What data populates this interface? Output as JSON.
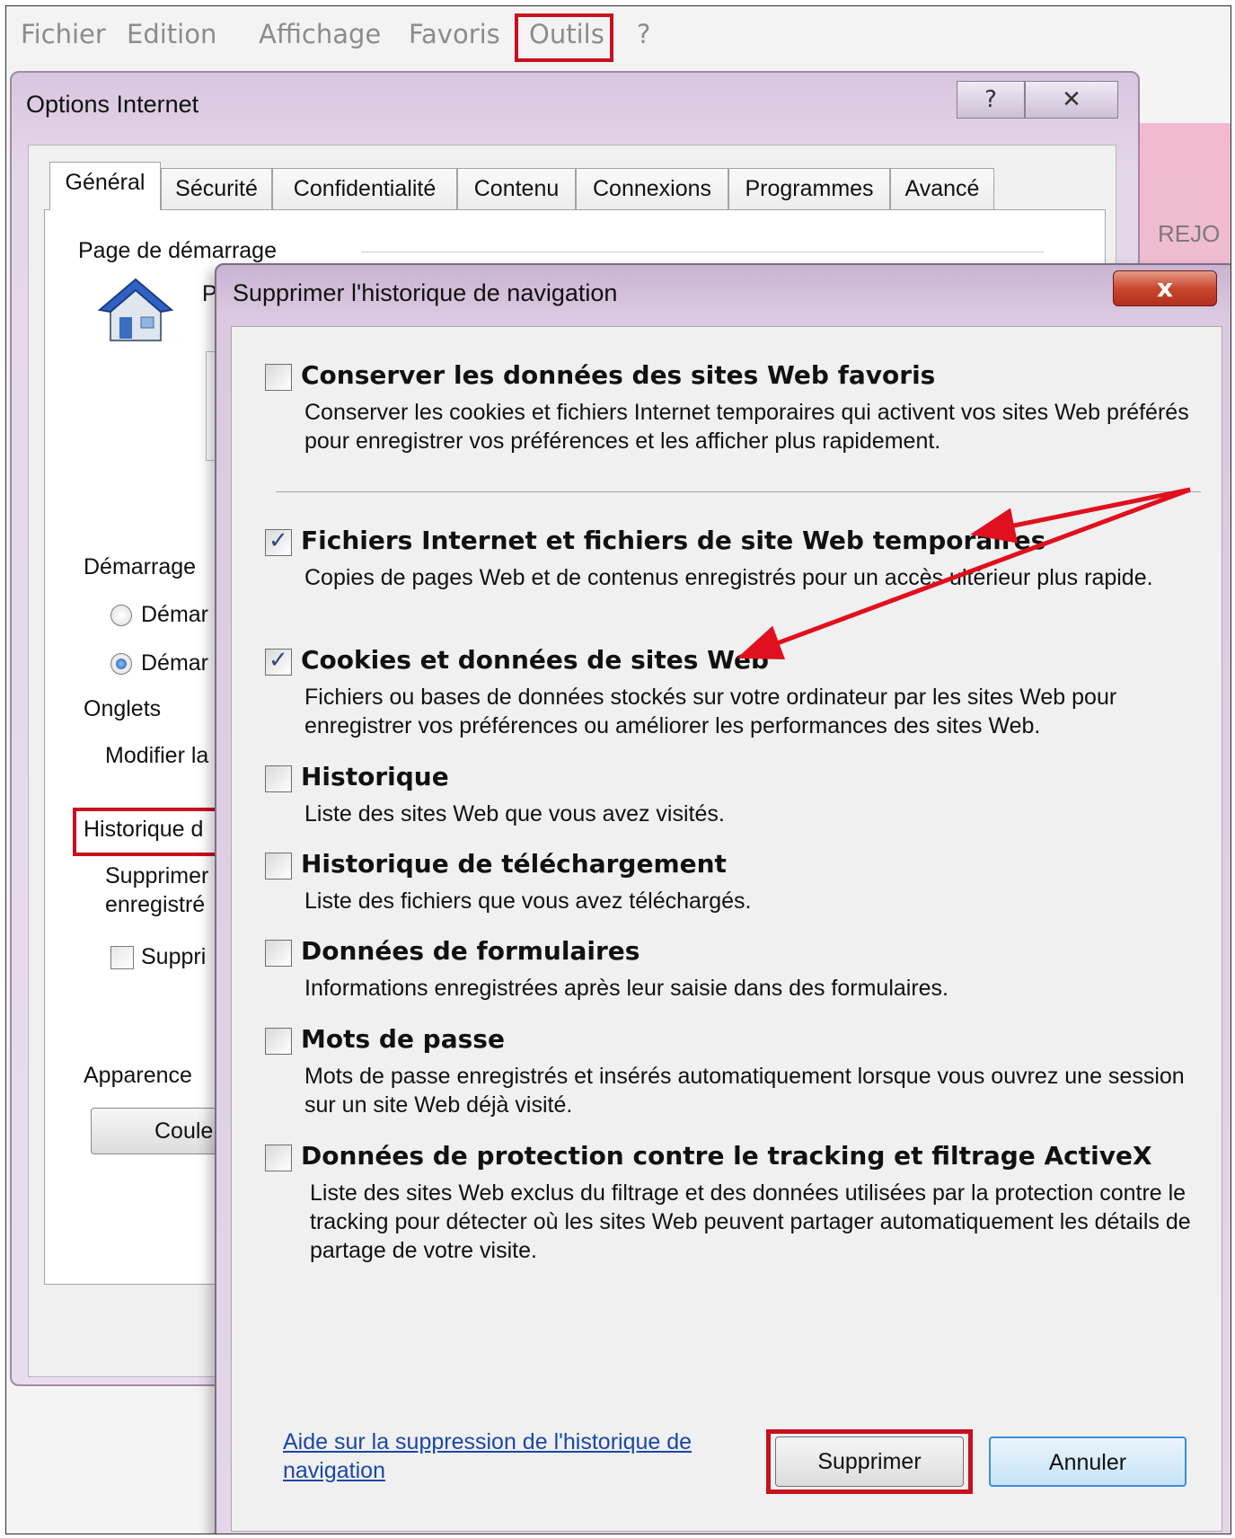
{
  "menubar": {
    "items": [
      "Fichier",
      "Edition",
      "Affichage",
      "Favoris",
      "Outils",
      "?"
    ]
  },
  "background_app": {
    "text": "REJO"
  },
  "options_window": {
    "title": "Options Internet",
    "help_button": "?",
    "close_button": "✕",
    "tabs": [
      "Général",
      "Sécurité",
      "Confidentialité",
      "Contenu",
      "Connexions",
      "Programmes",
      "Avancé"
    ],
    "page_demarrage": "Page de démarrage",
    "p_label": "P",
    "demarrage": "Démarrage",
    "radio1": "Démar",
    "radio2": "Démar",
    "onglets": "Onglets",
    "modifier": "Modifier la",
    "historique": "Historique d",
    "supprimer_text_1": "Supprimer",
    "supprimer_text_2": "enregistré",
    "suppr_checkbox": "Suppri",
    "apparence": "Apparence",
    "couleurs": "Coule"
  },
  "dialog": {
    "title": "Supprimer l'historique de navigation",
    "close": "x",
    "options": [
      {
        "title": "Conserver les données des sites Web favoris",
        "desc": "Conserver les cookies et fichiers Internet temporaires qui activent vos sites Web préférés pour enregistrer vos préférences et les afficher plus rapidement.",
        "checked": false
      },
      {
        "title": "Fichiers Internet et fichiers de site Web temporaires",
        "desc": "Copies de pages Web et de contenus enregistrés pour un accès ultérieur plus rapide.",
        "checked": true
      },
      {
        "title": "Cookies et données de sites Web",
        "desc": "Fichiers ou bases de données stockés sur votre ordinateur par les sites Web pour enregistrer vos préférences ou améliorer les performances des sites Web.",
        "checked": true
      },
      {
        "title": "Historique",
        "desc": "Liste des sites Web que vous avez visités.",
        "checked": false
      },
      {
        "title": "Historique de téléchargement",
        "desc": "Liste des fichiers que vous avez téléchargés.",
        "checked": false
      },
      {
        "title": "Données de formulaires",
        "desc": "Informations enregistrées après leur saisie dans des formulaires.",
        "checked": false
      },
      {
        "title": "Mots de passe",
        "desc": "Mots de passe enregistrés et insérés automatiquement lorsque vous ouvrez une session sur un site Web déjà visité.",
        "checked": false
      },
      {
        "title": "Données de protection contre le tracking et filtrage ActiveX",
        "desc": "Liste des sites Web exclus du filtrage et des données utilisées par la protection contre le tracking pour détecter où les sites Web peuvent partager automatiquement les détails de partage de votre visite.",
        "checked": false
      }
    ],
    "help_link": "Aide sur la suppression de l'historique de navigation",
    "supprimer": "Supprimer",
    "annuler": "Annuler"
  },
  "colors": {
    "highlight": "#c8101e",
    "link": "#1a47a8",
    "arrow": "#e0101e"
  }
}
